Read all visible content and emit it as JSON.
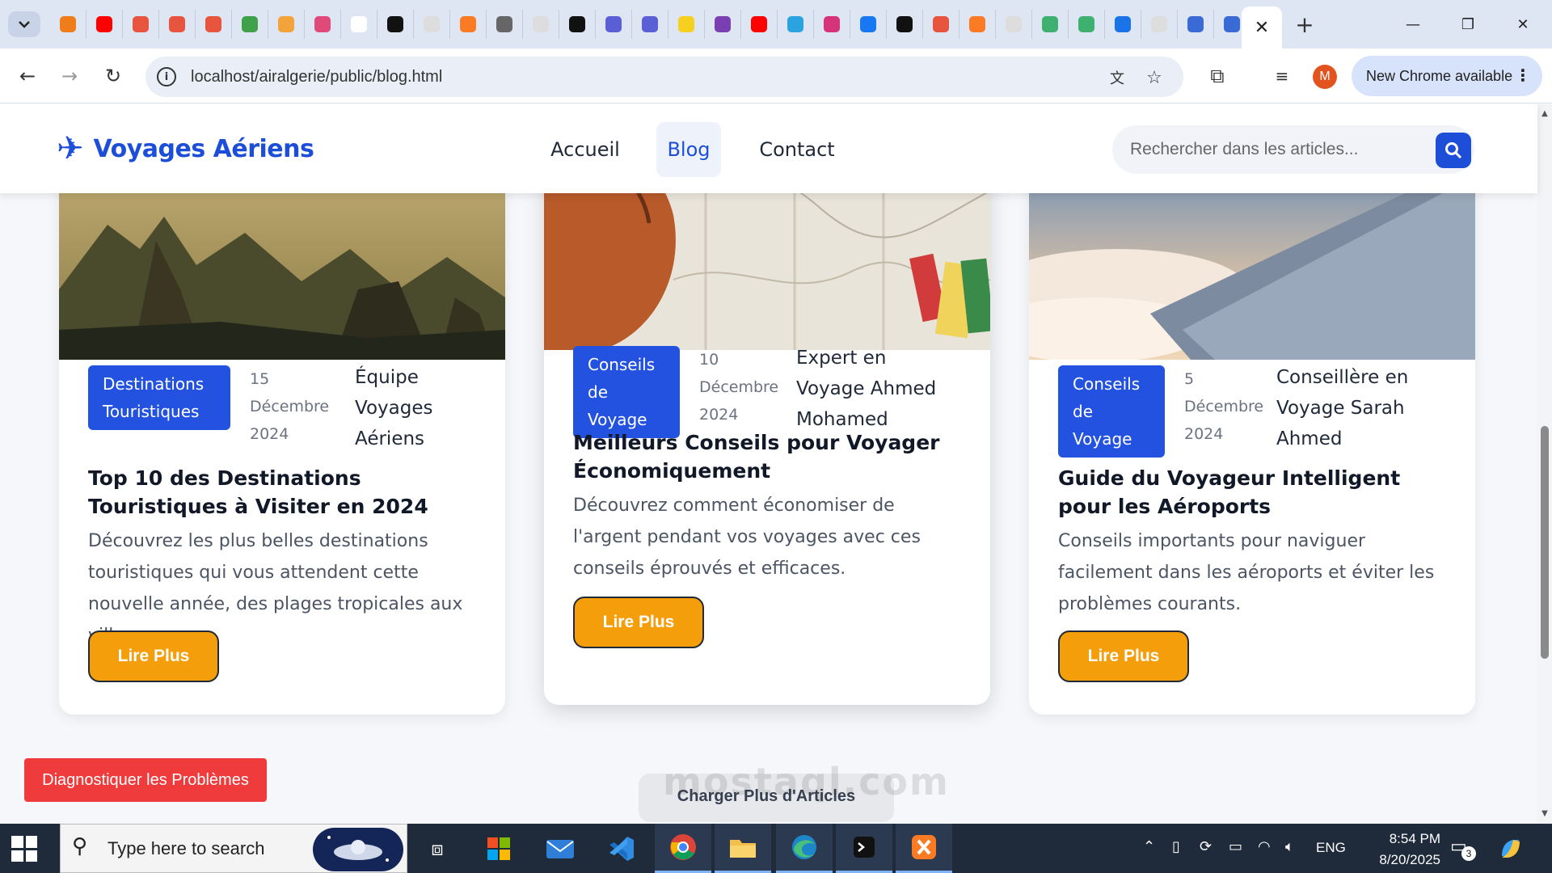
{
  "browser": {
    "tab_icons": [
      "pma-icon",
      "youtube-icon",
      "app-icon",
      "app-icon",
      "app-icon",
      "app-icon",
      "app-icon",
      "app-icon",
      "app-icon",
      "app-icon",
      "search-icon",
      "xampp-icon",
      "globe-icon",
      "search-icon",
      "openai-icon",
      "infinity-icon",
      "infinity-icon",
      "app-icon",
      "app-icon",
      "youtube-icon",
      "telegram-icon",
      "instagram-icon",
      "facebook-icon",
      "tiktok-icon",
      "app-icon",
      "xampp-icon",
      "search-icon",
      "edge-icon",
      "edge-icon",
      "app-icon",
      "search-icon",
      "bird-icon",
      "bird-icon"
    ],
    "url": "localhost/airalgerie/public/blog.html",
    "profile_initial": "M",
    "update_label": "New Chrome available"
  },
  "site": {
    "brand": "Voyages Aériens",
    "nav": [
      {
        "label": "Accueil",
        "active": false
      },
      {
        "label": "Blog",
        "active": true
      },
      {
        "label": "Contact",
        "active": false
      }
    ],
    "search_placeholder": "Rechercher dans les articles..."
  },
  "articles": [
    {
      "category": "Destinations Touristiques",
      "date": "15 Décembre 2024",
      "author": "Équipe Voyages Aériens",
      "title": "Top 10 des Destinations Touristiques à Visiter en 2024",
      "excerpt": "Découvrez les plus belles destinations touristiques qui vous attendent cette nouvelle année, des plages tropicales aux villes...",
      "button": "Lire Plus",
      "image": "mountain-landscape"
    },
    {
      "category": "Conseils de Voyage",
      "date": "10 Décembre 2024",
      "author": "Expert en Voyage Ahmed Mohamed",
      "title": "Meilleurs Conseils pour Voyager Économiquement",
      "excerpt": "Découvrez comment économiser de l'argent pendant vos voyages avec ces conseils éprouvés et efficaces.",
      "button": "Lire Plus",
      "image": "map-and-backpack"
    },
    {
      "category": "Conseils de Voyage",
      "date": "5 Décembre 2024",
      "author": "Conseillère en Voyage Sarah Ahmed",
      "title": "Guide du Voyageur Intelligent pour les Aéroports",
      "excerpt": "Conseils importants pour naviguer facilement dans les aéroports et éviter les problèmes courants.",
      "button": "Lire Plus",
      "image": "airplane-wing"
    }
  ],
  "actions": {
    "diagnose": "Diagnostiquer les Problèmes",
    "load_more": "Charger Plus d'Articles"
  },
  "watermark": "mostaql.com",
  "taskbar": {
    "search_placeholder": "Type here to search",
    "language": "ENG",
    "time": "8:54 PM",
    "date": "8/20/2025",
    "notifications": "3"
  },
  "colors": {
    "brand_blue": "#1d4ed8",
    "category_blue": "#2452e0",
    "button_orange": "#f59e0b",
    "diagnose_red": "#ef3b3b"
  }
}
